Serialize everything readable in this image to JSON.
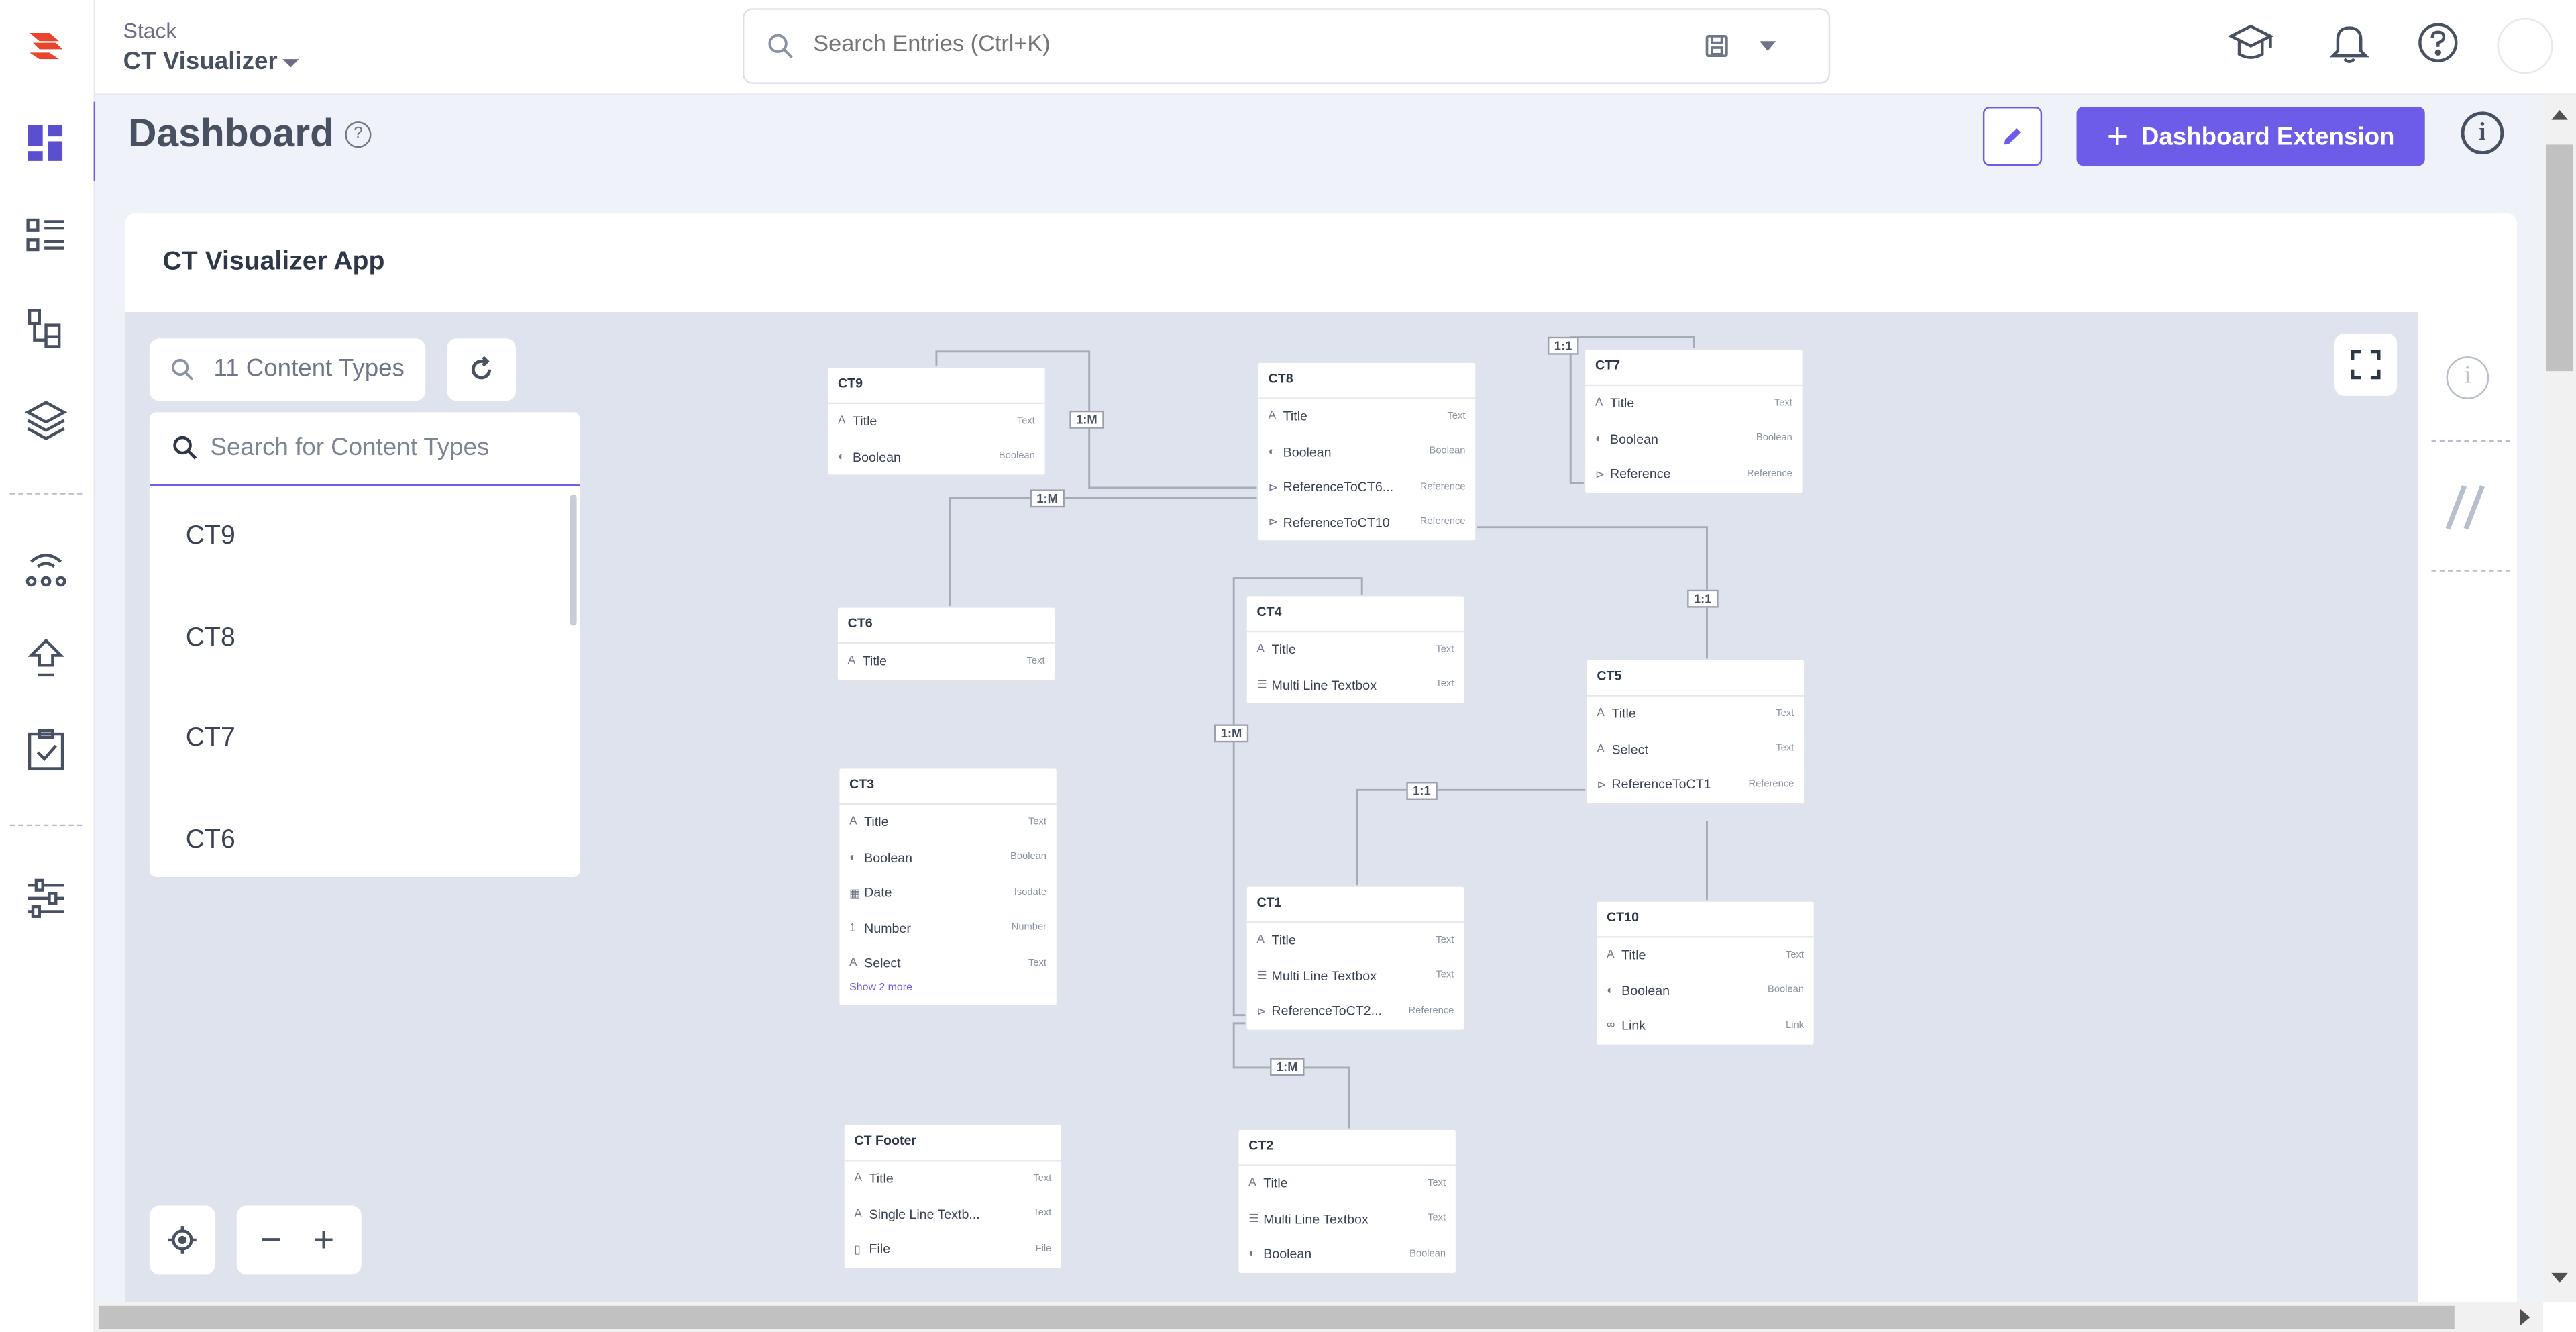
{
  "header": {
    "stack_label": "Stack",
    "stack_name": "CT Visualizer",
    "search_placeholder": "Search Entries (Ctrl+K)"
  },
  "page": {
    "title": "Dashboard",
    "help_glyph": "?",
    "extension_button": "Dashboard Extension",
    "plus_glyph": "+",
    "info_glyph": "i"
  },
  "card": {
    "title": "CT Visualizer App"
  },
  "canvas": {
    "count_label": "11 Content Types",
    "search_placeholder": "Search for Content Types",
    "list": [
      "CT9",
      "CT8",
      "CT7",
      "CT6"
    ],
    "zoom_minus": "−",
    "zoom_plus": "+"
  },
  "nodes": {
    "ct9": {
      "title": "CT9",
      "fields": [
        {
          "name": "Title",
          "type": "Text",
          "icon": "A"
        },
        {
          "name": "Boolean",
          "type": "Boolean",
          "icon": "◐"
        }
      ]
    },
    "ct8": {
      "title": "CT8",
      "fields": [
        {
          "name": "Title",
          "type": "Text",
          "icon": "A"
        },
        {
          "name": "Boolean",
          "type": "Boolean",
          "icon": "◐"
        },
        {
          "name": "ReferenceToCT6...",
          "type": "Reference",
          "icon": "⊳"
        },
        {
          "name": "ReferenceToCT10",
          "type": "Reference",
          "icon": "⊳"
        }
      ]
    },
    "ct7": {
      "title": "CT7",
      "fields": [
        {
          "name": "Title",
          "type": "Text",
          "icon": "A"
        },
        {
          "name": "Boolean",
          "type": "Boolean",
          "icon": "◐"
        },
        {
          "name": "Reference",
          "type": "Reference",
          "icon": "⊳"
        }
      ]
    },
    "ct6": {
      "title": "CT6",
      "fields": [
        {
          "name": "Title",
          "type": "Text",
          "icon": "A"
        }
      ]
    },
    "ct4": {
      "title": "CT4",
      "fields": [
        {
          "name": "Title",
          "type": "Text",
          "icon": "A"
        },
        {
          "name": "Multi Line Textbox",
          "type": "Text",
          "icon": "☰"
        }
      ]
    },
    "ct5": {
      "title": "CT5",
      "fields": [
        {
          "name": "Title",
          "type": "Text",
          "icon": "A"
        },
        {
          "name": "Select",
          "type": "Text",
          "icon": "A"
        },
        {
          "name": "ReferenceToCT1",
          "type": "Reference",
          "icon": "⊳"
        }
      ]
    },
    "ct3": {
      "title": "CT3",
      "fields": [
        {
          "name": "Title",
          "type": "Text",
          "icon": "A"
        },
        {
          "name": "Boolean",
          "type": "Boolean",
          "icon": "◐"
        },
        {
          "name": "Date",
          "type": "Isodate",
          "icon": "▦"
        },
        {
          "name": "Number",
          "type": "Number",
          "icon": "1"
        },
        {
          "name": "Select",
          "type": "Text",
          "icon": "A"
        }
      ],
      "show_more": "Show 2 more"
    },
    "ct1": {
      "title": "CT1",
      "fields": [
        {
          "name": "Title",
          "type": "Text",
          "icon": "A"
        },
        {
          "name": "Multi Line Textbox",
          "type": "Text",
          "icon": "☰"
        },
        {
          "name": "ReferenceToCT2...",
          "type": "Reference",
          "icon": "⊳"
        }
      ]
    },
    "ct10": {
      "title": "CT10",
      "fields": [
        {
          "name": "Title",
          "type": "Text",
          "icon": "A"
        },
        {
          "name": "Boolean",
          "type": "Boolean",
          "icon": "◐"
        },
        {
          "name": "Link",
          "type": "Link",
          "icon": "∞"
        }
      ]
    },
    "ctfooter": {
      "title": "CT Footer",
      "fields": [
        {
          "name": "Title",
          "type": "Text",
          "icon": "A"
        },
        {
          "name": "Single Line Textb...",
          "type": "Text",
          "icon": "A"
        },
        {
          "name": "File",
          "type": "File",
          "icon": "▯"
        }
      ]
    },
    "ct2": {
      "title": "CT2",
      "fields": [
        {
          "name": "Title",
          "type": "Text",
          "icon": "A"
        },
        {
          "name": "Multi Line Textbox",
          "type": "Text",
          "icon": "☰"
        },
        {
          "name": "Boolean",
          "type": "Boolean",
          "icon": "◐"
        }
      ]
    }
  },
  "edges": {
    "e1": "1:M",
    "e2": "1:M",
    "e3": "1:1",
    "e4": "1:1",
    "e5": "1:M",
    "e6": "1:1",
    "e7": "1:M"
  },
  "colors": {
    "accent": "#6c5ce7",
    "brand_red": "#e8452c",
    "canvas_bg": "#dfe3ee"
  }
}
